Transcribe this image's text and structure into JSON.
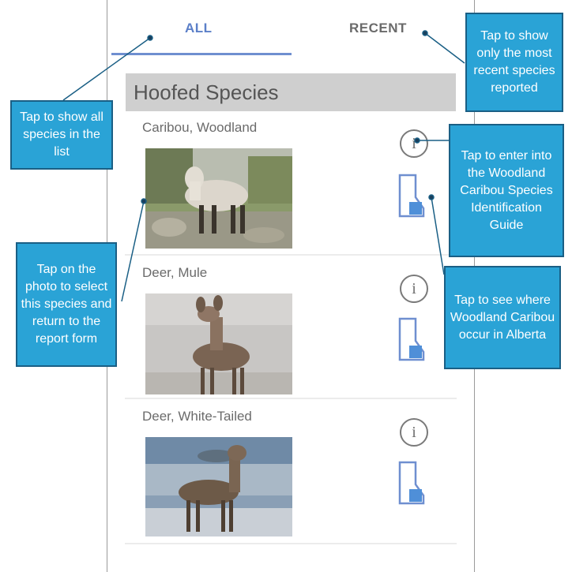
{
  "tabs": {
    "all_label": "ALL",
    "recent_label": "RECENT"
  },
  "section": {
    "title": "Hoofed Species"
  },
  "species": [
    {
      "name": "Caribou, Woodland",
      "info_glyph": "i"
    },
    {
      "name": "Deer, Mule",
      "info_glyph": "i"
    },
    {
      "name": "Deer, White-Tailed",
      "info_glyph": "i"
    }
  ],
  "callouts": {
    "all_tab": "Tap to show all species in the list",
    "recent_tab": "Tap to show only the most recent species reported",
    "info": "Tap to enter into the Woodland Caribou Species Identification Guide",
    "photo": "Tap on the photo to select this species and return to the report form",
    "map": "Tap to see where Woodland Caribou occur in Alberta"
  },
  "colors": {
    "accent": "#5b7fc8",
    "callout_bg": "#2aa3d6",
    "callout_border": "#1a5f85"
  },
  "icons": {
    "info": "info-icon",
    "map": "alberta-map-icon"
  }
}
